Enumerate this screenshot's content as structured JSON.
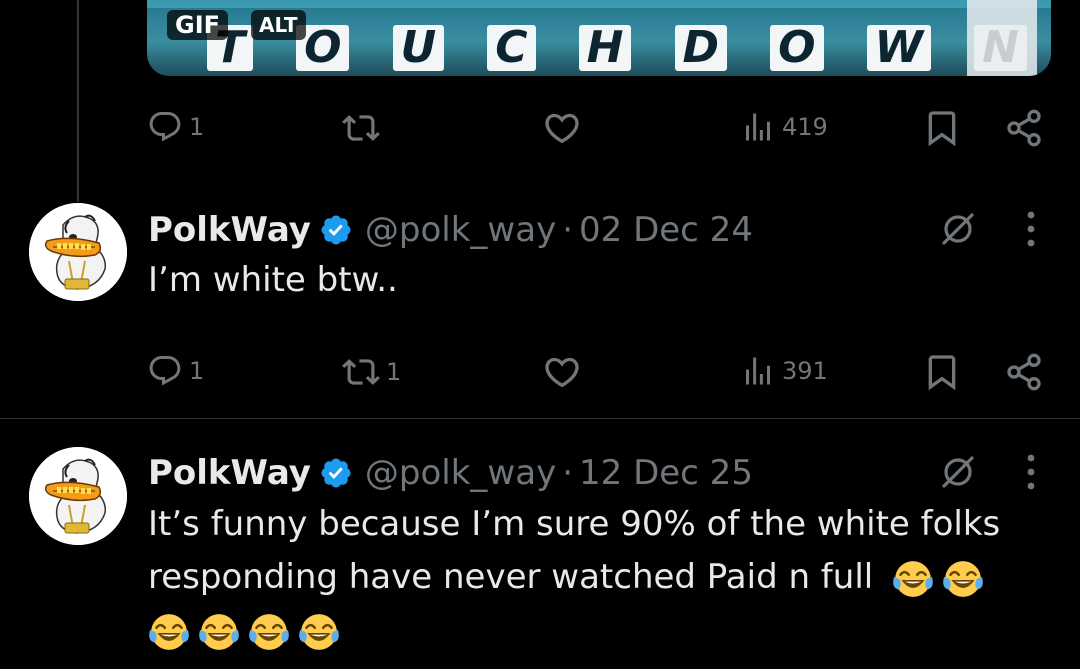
{
  "prev_tweet": {
    "media": {
      "gif_badge": "GIF",
      "alt_badge": "ALT",
      "letters": [
        "T",
        "O",
        "U",
        "C",
        "H",
        "D",
        "O",
        "W",
        "N"
      ]
    },
    "actions": {
      "replies": "1",
      "reposts": "",
      "likes": "",
      "views": "419"
    }
  },
  "tweets": [
    {
      "display_name": "PolkWay",
      "handle": "@polk_way",
      "separator": "·",
      "date": "02 Dec 24",
      "text": "I’m white btw..",
      "actions": {
        "replies": "1",
        "reposts": "1",
        "likes": "",
        "views": "391"
      }
    },
    {
      "display_name": "PolkWay",
      "handle": "@polk_way",
      "separator": "·",
      "date": "12 Dec 25",
      "text_line1": "It’s funny because I’m sure 90% of the white folks",
      "text_line2": "responding have never watched Paid n full",
      "emoji_name": "face-with-tears-of-joy",
      "emoji_count": 6
    }
  ],
  "colors": {
    "background": "#000000",
    "text": "#e7e9ea",
    "secondary": "#71767b",
    "verified": "#1d9bf0",
    "divider": "#2f3336"
  }
}
